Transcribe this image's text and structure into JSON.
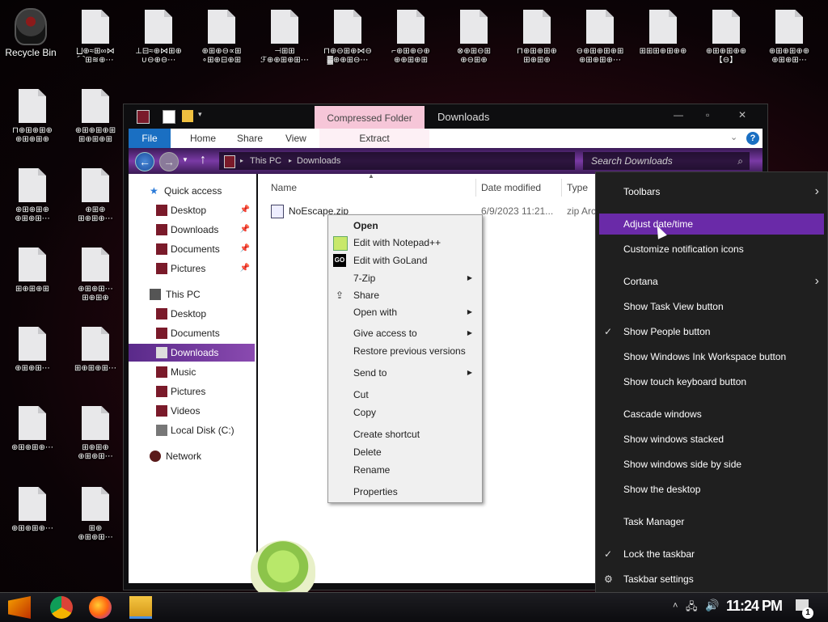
{
  "desktop": {
    "recycle_bin": "Recycle Bin",
    "icons": [
      {
        "l1": "⨆⊕≈⊞∞⋈",
        "l2": "⌒⊞≋⊕⋯"
      },
      {
        "l1": "⊥⊟≈⊕⋈⊞⊕",
        "l2": "∪⊖⊕⊖⋯"
      },
      {
        "l1": "⊕⊞⊕⊖∝⊞",
        "l2": "∘⊞⊕⊟⊕⊞"
      },
      {
        "l1": "⊣⊞⊞",
        "l2": "ℱ⊕⊕⊞⊕⊞⋯"
      },
      {
        "l1": "⊓⊕⊖⊞⊕⋈⊖",
        "l2": "▓⊕⊕⊞⊖⋯"
      },
      {
        "l1": "⌐⊕⊞⊕⊖⊕",
        "l2": "⊕⊕⊞⊕⊞"
      },
      {
        "l1": "⊗⊕⊞⊖⊞",
        "l2": "⊕⊖⊞⊕"
      },
      {
        "l1": "⊓⊕⊞⊕⊞⊕",
        "l2": "⊞⊕⊞⊕"
      },
      {
        "l1": "⊖⊕⊞⊕⊞⊕⊞",
        "l2": "⊕⊞⊕⊞⊕⋯"
      },
      {
        "l1": "⊞⊞⊞⊕⊞⊕⊕",
        "l2": ""
      },
      {
        "l1": "⊕⊞⊕⊞⊕⊕",
        "l2": "【⊖】"
      },
      {
        "l1": "⊕⊞⊕⊞⊕⊕",
        "l2": "⊕⊞⊕⊞⋯"
      },
      {
        "l1": "⊓⊕⊞⊕⊞⊕",
        "l2": "⊕⊞⊕⊞⊕"
      },
      {
        "l1": "⊕⊞⊕⊞⊕⊞",
        "l2": "⊞⊕⊞⊕⊞"
      },
      {
        "l1": "⊕⊞⊕⊞⊕",
        "l2": "⊕⊞⊕⊞⋯"
      },
      {
        "l1": "⊕⊞⊕",
        "l2": "⊞⊕⊞⊕⋯"
      },
      {
        "l1": "⊞⊕⊞⊕⊞",
        "l2": ""
      },
      {
        "l1": "⊕⊞⊕⊞⋯",
        "l2": "⊞⊕⊞⊕"
      },
      {
        "l1": "⊕⊞⊕⊞⋯",
        "l2": ""
      },
      {
        "l1": "⊞⊕⊞⊕⊞⋯",
        "l2": ""
      },
      {
        "l1": "⊕⊞⊕⊞⊕⋯",
        "l2": ""
      },
      {
        "l1": "⊞⊕⊞⊕",
        "l2": "⊕⊞⊕⊞⋯"
      },
      {
        "l1": "⊕⊞⊕⊞⊕⋯",
        "l2": ""
      },
      {
        "l1": "⊞⊕",
        "l2": "⊕⊞⊕⊞⋯"
      }
    ]
  },
  "explorer": {
    "contextual_tab": "Compressed Folder Tools",
    "window_title": "Downloads",
    "ribbon_tabs": [
      "File",
      "Home",
      "Share",
      "View",
      "Extract"
    ],
    "address": {
      "root": "This PC",
      "folder": "Downloads"
    },
    "search_placeholder": "Search Downloads",
    "nav": {
      "quick_access": "Quick access",
      "qa_items": [
        "Desktop",
        "Downloads",
        "Documents",
        "Pictures"
      ],
      "this_pc": "This PC",
      "pc_items": [
        "Desktop",
        "Documents",
        "Downloads",
        "Music",
        "Pictures",
        "Videos",
        "Local Disk (C:)"
      ],
      "network": "Network"
    },
    "columns": [
      "Name",
      "Date modified",
      "Type"
    ],
    "file": {
      "name": "NoEscape.zip",
      "date": "6/9/2023 11:21...",
      "type": "zip Arch"
    }
  },
  "file_menu": {
    "items": [
      "Open",
      "Edit with Notepad++",
      "Edit with GoLand",
      "7-Zip",
      "Share",
      "Open with",
      "Give access to",
      "Restore previous versions",
      "Send to",
      "Cut",
      "Copy",
      "Create shortcut",
      "Delete",
      "Rename",
      "Properties"
    ]
  },
  "taskbar_menu": {
    "items": [
      "Toolbars",
      "Adjust date/time",
      "Customize notification icons",
      "Cortana",
      "Show Task View button",
      "Show People button",
      "Show Windows Ink Workspace button",
      "Show touch keyboard button",
      "Cascade windows",
      "Show windows stacked",
      "Show windows side by side",
      "Show the desktop",
      "Task Manager",
      "Lock the taskbar",
      "Taskbar settings"
    ]
  },
  "taskbar": {
    "clock": "11:24 PM",
    "notif_count": "1"
  },
  "colors": {
    "accent": "#6a2aa8",
    "file_tab": "#1a6fc2",
    "contextual_tab": "#f6c6d8"
  }
}
